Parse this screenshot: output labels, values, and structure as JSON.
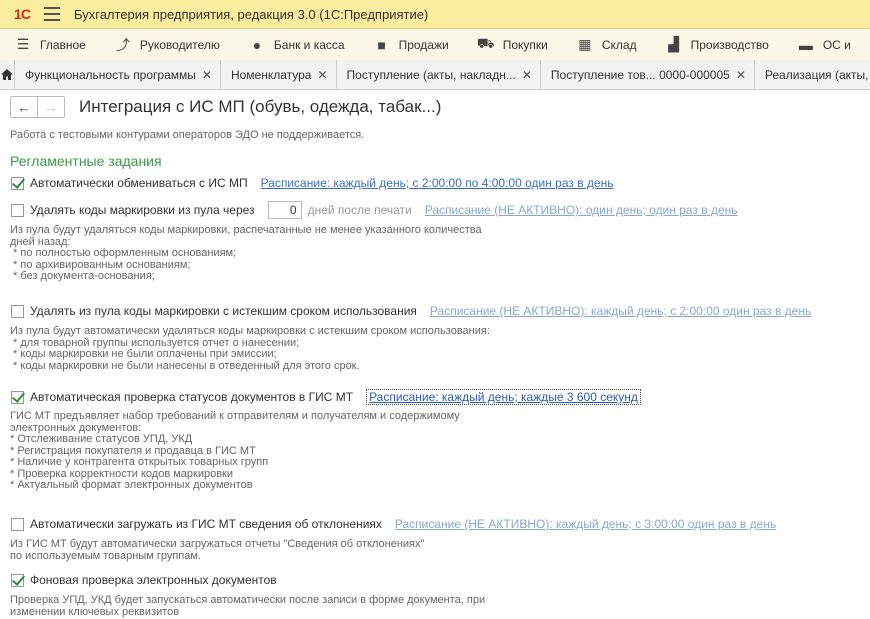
{
  "app": {
    "title": "Бухгалтерия предприятия, редакция 3.0  (1С:Предприятие)",
    "logo_text": "1С"
  },
  "menu": [
    {
      "icon": "menu-lines-icon",
      "label": "Главное"
    },
    {
      "icon": "trend-icon",
      "label": "Руководителю"
    },
    {
      "icon": "coin-icon",
      "label": "Банк и касса"
    },
    {
      "icon": "bag-icon",
      "label": "Продажи"
    },
    {
      "icon": "cart-icon",
      "label": "Покупки"
    },
    {
      "icon": "warehouse-icon",
      "label": "Склад"
    },
    {
      "icon": "factory-icon",
      "label": "Производство"
    },
    {
      "icon": "truck-icon",
      "label": "ОС и"
    }
  ],
  "tabs": [
    {
      "label": "Функциональность программы"
    },
    {
      "label": "Номенклатура"
    },
    {
      "label": "Поступление (акты, накладн..."
    },
    {
      "label": "Поступление тов... 0000-000005"
    },
    {
      "label": "Реализация (акты, на"
    }
  ],
  "page": {
    "title": "Интеграция с ИС МП (обувь, одежда, табак...)"
  },
  "content": {
    "clipped_text": "Работа с тестовыми контурами операторов ЭДО не поддерживается.",
    "section_title": "Регламентные задания",
    "auto_exchange": {
      "label": "Автоматически обмениваться с ИС МП",
      "checked": true,
      "schedule": "Расписание: каждый день; с 2:00:00 по 4:00:00 один раз в день"
    },
    "delete_codes": {
      "label": "Удалять коды маркировки из пула через",
      "checked": false,
      "days": "0",
      "days_suffix": "дней после печати",
      "schedule": "Расписание (НЕ АКТИВНО): один день; один раз в день"
    },
    "delete_codes_desc": "Из пула будут удаляться коды маркировки, распечатанные не менее указанного количества\nдней назад:\n * по полностью оформленным основаниям;\n * по архивированным основаниям;\n * без документа-основания;",
    "delete_expired": {
      "label": "Удалять из пула коды маркировки с истекшим сроком использования",
      "checked": false,
      "schedule": "Расписание (НЕ АКТИВНО): каждый день; с 2:00:00 один раз в день"
    },
    "delete_expired_desc": "Из пула будут автоматически удаляться коды маркировки с истекшим сроком использования:\n * для товарной группы используется отчет о нанесении;\n * коды маркировки не были оплачены при эмиссии;\n * коды маркировки не были нанесены в отведенный для этого срок.",
    "status_check": {
      "label": "Автоматическая проверка статусов документов в ГИС МТ",
      "checked": true,
      "schedule": "Расписание: каждый день; каждые 3 600 секунд"
    },
    "status_check_desc": "ГИС МТ предъявляет набор требований к отправителям и получателям и содержимому\nэлектронных документов:\n* Отслеживание статусов УПД, УКД\n* Регистрация покупателя и продавца в ГИС МТ\n* Наличие у контрагента открытых товарных групп\n* Проверка корректности кодов маркировки\n* Актуальный формат электронных документов",
    "deviations": {
      "label": "Автоматически загружать из ГИС МТ сведения об отклонениях",
      "checked": false,
      "schedule": "Расписание (НЕ АКТИВНО): каждый день; с 3:00:00 один раз в день"
    },
    "deviations_desc": "Из ГИС МТ будут автоматически загружаться отчеты \"Сведения об отклонениях\"\nпо используемым товарным группам.",
    "background_check": {
      "label": "Фоновая проверка электронных документов",
      "checked": true
    },
    "background_check_desc": "Проверка УПД, УКД будет запускаться автоматически после записи в форме документа, при\nизменении ключевых реквизитов"
  }
}
